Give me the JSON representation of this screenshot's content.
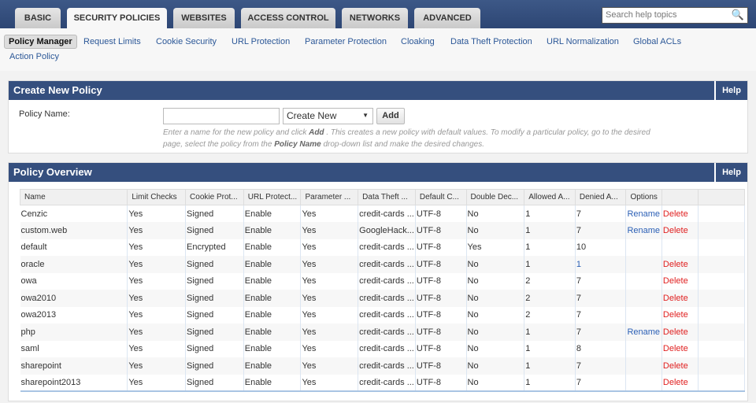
{
  "tabs": [
    "BASIC",
    "SECURITY POLICIES",
    "WEBSITES",
    "ACCESS CONTROL",
    "NETWORKS",
    "ADVANCED"
  ],
  "active_tab": "SECURITY POLICIES",
  "search": {
    "placeholder": "Search help topics",
    "icon": "search-icon"
  },
  "subnav": [
    "Policy Manager",
    "Request Limits",
    "Cookie Security",
    "URL Protection",
    "Parameter Protection",
    "Cloaking",
    "Data Theft Protection",
    "URL Normalization",
    "Global ACLs",
    "Action Policy"
  ],
  "create": {
    "title": "Create New Policy",
    "help": "Help",
    "label": "Policy Name:",
    "name_value": "",
    "select_value": "Create New",
    "add": "Add",
    "hint_1": "Enter a name for the new policy and click ",
    "hint_b1": "Add",
    "hint_2": " . This creates a new policy with default values. To modify a particular policy, go to the desired page, select the policy from the ",
    "hint_b2": "Policy Name",
    "hint_3": " drop-down list and make the desired changes."
  },
  "overview": {
    "title": "Policy Overview",
    "help": "Help",
    "columns": [
      "Name",
      "Limit Checks",
      "Cookie Prot...",
      "URL Protect...",
      "Parameter ...",
      "Data Theft ...",
      "Default C...",
      "Double Dec...",
      "Allowed A...",
      "Denied A...",
      "Options",
      "",
      ""
    ],
    "rows": [
      [
        "Cenzic",
        "Yes",
        "Signed",
        "Enable",
        "Yes",
        "credit-cards ...",
        "UTF-8",
        "No",
        "1",
        "7",
        "Rename",
        "Delete"
      ],
      [
        "custom.web",
        "Yes",
        "Signed",
        "Enable",
        "Yes",
        "GoogleHack...",
        "UTF-8",
        "No",
        "1",
        "7",
        "Rename",
        "Delete"
      ],
      [
        "default",
        "Yes",
        "Encrypted",
        "Enable",
        "Yes",
        "credit-cards ...",
        "UTF-8",
        "Yes",
        "1",
        "10",
        "",
        ""
      ],
      [
        "oracle",
        "Yes",
        "Signed",
        "Enable",
        "Yes",
        "credit-cards ...",
        "UTF-8",
        "No",
        "1",
        "1",
        "",
        "Delete"
      ],
      [
        "owa",
        "Yes",
        "Signed",
        "Enable",
        "Yes",
        "credit-cards ...",
        "UTF-8",
        "No",
        "2",
        "7",
        "",
        "Delete"
      ],
      [
        "owa2010",
        "Yes",
        "Signed",
        "Enable",
        "Yes",
        "credit-cards ...",
        "UTF-8",
        "No",
        "2",
        "7",
        "",
        "Delete"
      ],
      [
        "owa2013",
        "Yes",
        "Signed",
        "Enable",
        "Yes",
        "credit-cards ...",
        "UTF-8",
        "No",
        "2",
        "7",
        "",
        "Delete"
      ],
      [
        "php",
        "Yes",
        "Signed",
        "Enable",
        "Yes",
        "credit-cards ...",
        "UTF-8",
        "No",
        "1",
        "7",
        "Rename",
        "Delete"
      ],
      [
        "saml",
        "Yes",
        "Signed",
        "Enable",
        "Yes",
        "credit-cards ...",
        "UTF-8",
        "No",
        "1",
        "8",
        "",
        "Delete"
      ],
      [
        "sharepoint",
        "Yes",
        "Signed",
        "Enable",
        "Yes",
        "credit-cards ...",
        "UTF-8",
        "No",
        "1",
        "7",
        "",
        "Delete"
      ],
      [
        "sharepoint2013",
        "Yes",
        "Signed",
        "Enable",
        "Yes",
        "credit-cards ...",
        "UTF-8",
        "No",
        "1",
        "7",
        "",
        "Delete"
      ]
    ]
  },
  "colors": {
    "header": "#354f7e",
    "link": "#2b5fb5",
    "delete": "#e02020"
  }
}
